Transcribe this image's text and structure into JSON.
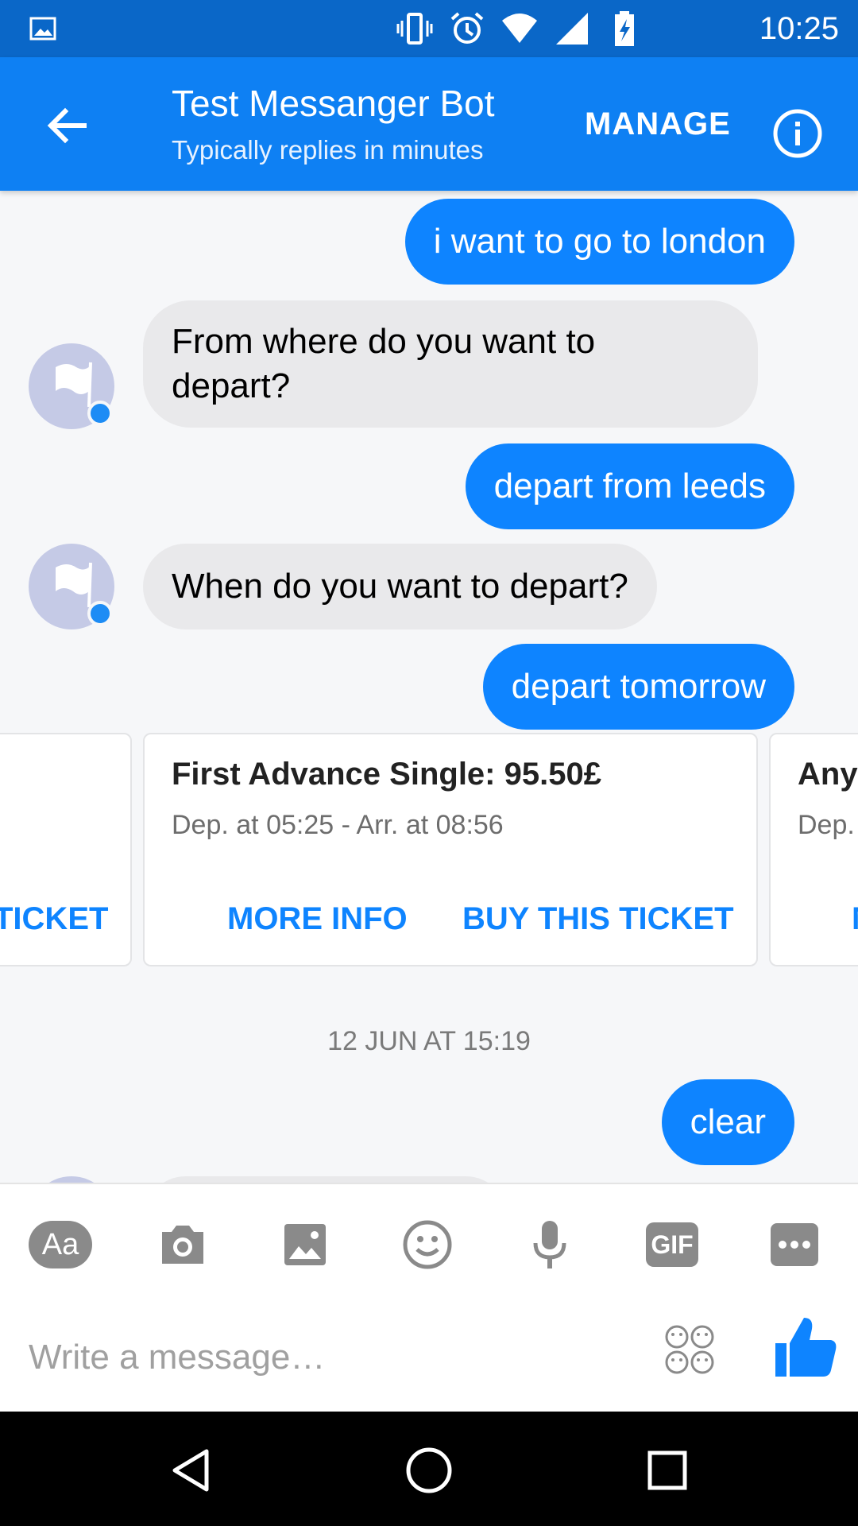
{
  "status_bar": {
    "time": "10:25",
    "icons": [
      "image-icon",
      "vibrate-icon",
      "alarm-icon",
      "wifi-icon",
      "signal-icon",
      "battery-charging-icon"
    ]
  },
  "header": {
    "title": "Test Messanger Bot",
    "subtitle": "Typically replies in minutes",
    "manage_label": "MANAGE",
    "back_icon": "back-arrow-icon",
    "info_icon": "info-icon"
  },
  "messages": [
    {
      "direction": "out",
      "text": "i want to go to london"
    },
    {
      "direction": "in",
      "text": "From where do you want to depart?"
    },
    {
      "direction": "out",
      "text": "depart from leeds"
    },
    {
      "direction": "in",
      "text": "When do you want to depart?"
    },
    {
      "direction": "out",
      "text": "depart tomorrow"
    },
    {
      "direction": "out",
      "text": "clear"
    }
  ],
  "cards": [
    {
      "title": "",
      "subtitle": "",
      "buttons": [
        "TICKET"
      ]
    },
    {
      "title": "First Advance Single: 95.50£",
      "subtitle": "Dep. at 05:25 - Arr. at 08:56",
      "buttons": [
        "MORE INFO",
        "BUY THIS TICKET"
      ]
    },
    {
      "title": "Anyt",
      "subtitle": "Dep.",
      "buttons": [
        "M"
      ]
    }
  ],
  "timestamp": "12 JUN AT 15:19",
  "composer": {
    "placeholder": "Write a message…",
    "tools": [
      "text-format-icon",
      "camera-icon",
      "gallery-icon",
      "emoji-icon",
      "microphone-icon",
      "gif-icon",
      "more-icon"
    ],
    "text_format_label": "Aa",
    "gif_label": "GIF"
  },
  "nav": [
    "back-nav-icon",
    "home-nav-icon",
    "recents-nav-icon"
  ],
  "colors": {
    "status_bar": "#0a67c8",
    "app_bar": "#0e80f3",
    "outgoing_bubble": "#0e84ff",
    "incoming_bubble": "#e9e9eb",
    "chat_background": "#f6f7f9"
  }
}
